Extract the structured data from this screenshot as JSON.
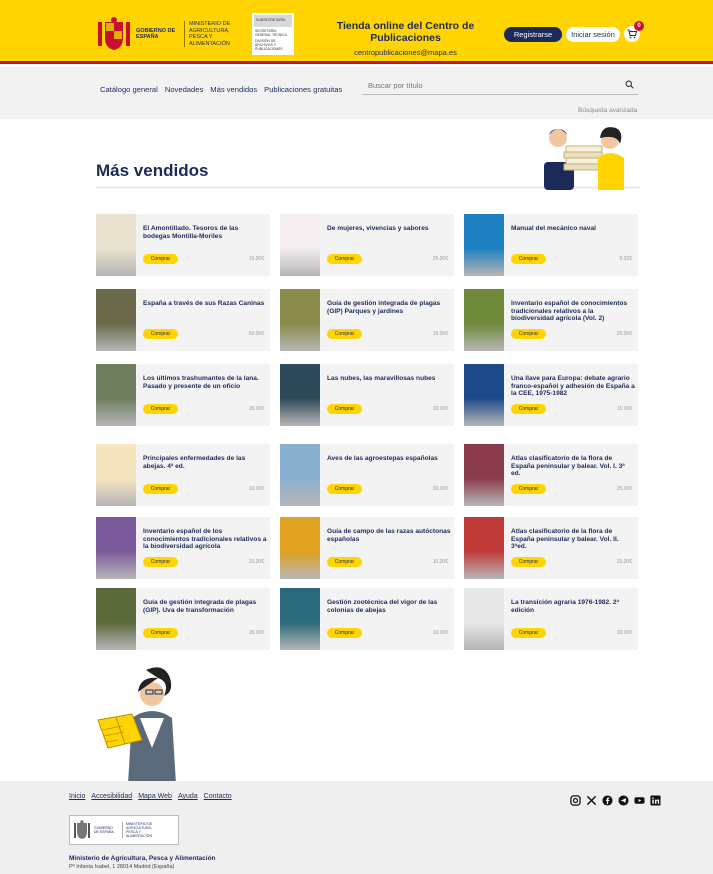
{
  "header": {
    "gov_text": "GOBIERNO DE ESPAÑA",
    "ministry_text": "MINISTERIO DE AGRICULTURA, PESCA Y ALIMENTACIÓN",
    "sub_head": "SUBSECRETARÍA",
    "sub_line1": "SECRETARÍA GENERAL TÉCNICA",
    "sub_line2": "DIVISIÓN DE ARCHIVOS Y PUBLICACIONES",
    "store_title": "Tienda online del Centro de Publicaciones",
    "store_email": "centropublicaciones@mapa.es",
    "register_label": "Registrarse",
    "login_label": "Iniciar sesión",
    "cart_count": "0"
  },
  "nav": {
    "items": [
      "Catálogo general",
      "Novedades",
      "Más vendidos",
      "Publicaciones gratuitas"
    ],
    "search_placeholder": "Buscar por título",
    "advanced_search": "Búsqueda avanzada"
  },
  "page": {
    "title": "Más vendidos"
  },
  "buy_label": "Comprar",
  "products": [
    {
      "title": "El Amontillado. Tesoros de las bodegas Montilla-Moriles",
      "price": "15.00€",
      "cover": "#e9e2cf"
    },
    {
      "title": "De mujeres, vivencias y sabores",
      "price": "25.00€",
      "cover": "#f4eef0"
    },
    {
      "title": "Manual del mecánico naval",
      "price": "9.02€",
      "cover": "#1d7fc0"
    },
    {
      "title": "España a través de sus Razas Caninas",
      "price": "50.00€",
      "cover": "#6a6a4a"
    },
    {
      "title": "Guía de gestión integrada de plagas (GIP) Parques y jardines",
      "price": "15.00€",
      "cover": "#8a8a4a"
    },
    {
      "title": "Inventario español de conocimientos tradicionales relativos a la biodiversidad agrícola (Vol. 2)",
      "price": "20.00€",
      "cover": "#6e8a3a"
    },
    {
      "title": "Los últimos trashumantes de la lana. Pasado y presente de un oficio",
      "price": "15.00€",
      "cover": "#6e7e5e"
    },
    {
      "title": "Las nubes, las maravillosas nubes",
      "price": "20.00€",
      "cover": "#2d4a5a"
    },
    {
      "title": "Una llave para Europa: debate agrario franco-español y adhesión de España a la CEE, 1975-1982",
      "price": "11.00€",
      "cover": "#1d4a8a"
    },
    {
      "title": "Principales enfermedades de las abejas. 4ª ed.",
      "price": "10.00€",
      "cover": "#f6e6c0"
    },
    {
      "title": "Aves de las agroestepas españolas",
      "price": "30.00€",
      "cover": "#8ab0d0"
    },
    {
      "title": "Atlas clasificatorio de la flora de España peninsular y balear. Vol. I. 3ª ed.",
      "price": "25.00€",
      "cover": "#8a3a4a"
    },
    {
      "title": "Inventario español de los conocimientos tradicionales relativos a la biodiversidad agrícola",
      "price": "20.00€",
      "cover": "#7a5a9a"
    },
    {
      "title": "Guía de campo de las razas autóctonas españolas",
      "price": "10.00€",
      "cover": "#e0a020"
    },
    {
      "title": "Atlas clasificatorio de la flora de España peninsular y balear. Vol. II. 3ªed.",
      "price": "25.00€",
      "cover": "#c03a3a"
    },
    {
      "title": "Guía de gestión integrada de plagas (GIP). Uva de transformación",
      "price": "15.00€",
      "cover": "#5a6a3a"
    },
    {
      "title": "Gestión zootécnica del vigor de las colonias de abejas",
      "price": "10.00€",
      "cover": "#2a6a7a"
    },
    {
      "title": "La transición agraria 1976-1982. 2ª edición",
      "price": "20.00€",
      "cover": "#e8e8e8"
    }
  ],
  "footer": {
    "links": [
      "Inicio",
      "Accesibilidad",
      "Mapa Web",
      "Ayuda",
      "Contacto"
    ],
    "logo_gov": "GOBIERNO DE ESPAÑA",
    "logo_ministry": "MINISTERIO DE AGRICULTURA, PESCA Y ALIMENTACIÓN",
    "ministry": "Ministerio de Agricultura, Pesca y Alimentación",
    "address": "Pº Infanta Isabel, 1 28014 Madrid (España)",
    "social_icons": [
      "instagram-icon",
      "x-icon",
      "facebook-icon",
      "telegram-icon",
      "youtube-icon",
      "linkedin-icon"
    ]
  },
  "colors": {
    "brand_yellow": "#ffd400",
    "brand_navy": "#1c2a5a",
    "accent_red": "#c8102e"
  }
}
